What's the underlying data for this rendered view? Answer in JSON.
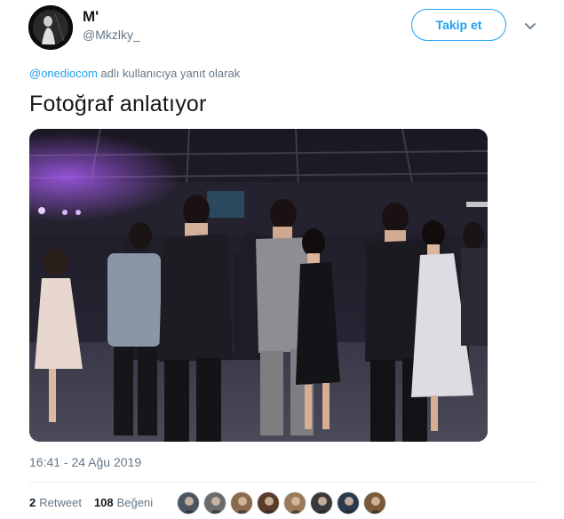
{
  "author": {
    "display_name": "M'",
    "handle": "@Mkzlky_",
    "avatar_icon": "person-silhouette-avatar"
  },
  "follow_button": {
    "label": "Takip et"
  },
  "menu": {
    "icon": "chevron-down-icon"
  },
  "reply_context": {
    "mention": "@onediocom",
    "suffix": " adlı kullanıcıya yanıt olarak"
  },
  "tweet": {
    "text": "Fotoğraf anlatıyor",
    "media_icon": "photo-dance-party"
  },
  "timestamp": "16:41 - 24 Ağu 2019",
  "stats": {
    "retweets_count": "2",
    "retweets_label": "Retweet",
    "likes_count": "108",
    "likes_label": "Beğeni"
  },
  "likers": [
    {
      "name": "liker-avatar-1",
      "color": "#4a5560"
    },
    {
      "name": "liker-avatar-2",
      "color": "#6b6b6b"
    },
    {
      "name": "liker-avatar-3",
      "color": "#8a6a4a"
    },
    {
      "name": "liker-avatar-4",
      "color": "#5a3a2a"
    },
    {
      "name": "liker-avatar-5",
      "color": "#9a7a5a"
    },
    {
      "name": "liker-avatar-6",
      "color": "#3a3a3a"
    },
    {
      "name": "liker-avatar-7",
      "color": "#2a3a4a"
    },
    {
      "name": "liker-avatar-8",
      "color": "#7a5a3a"
    }
  ],
  "colors": {
    "accent": "#1da1f2",
    "secondary_text": "#657786",
    "primary_text": "#14171a"
  }
}
